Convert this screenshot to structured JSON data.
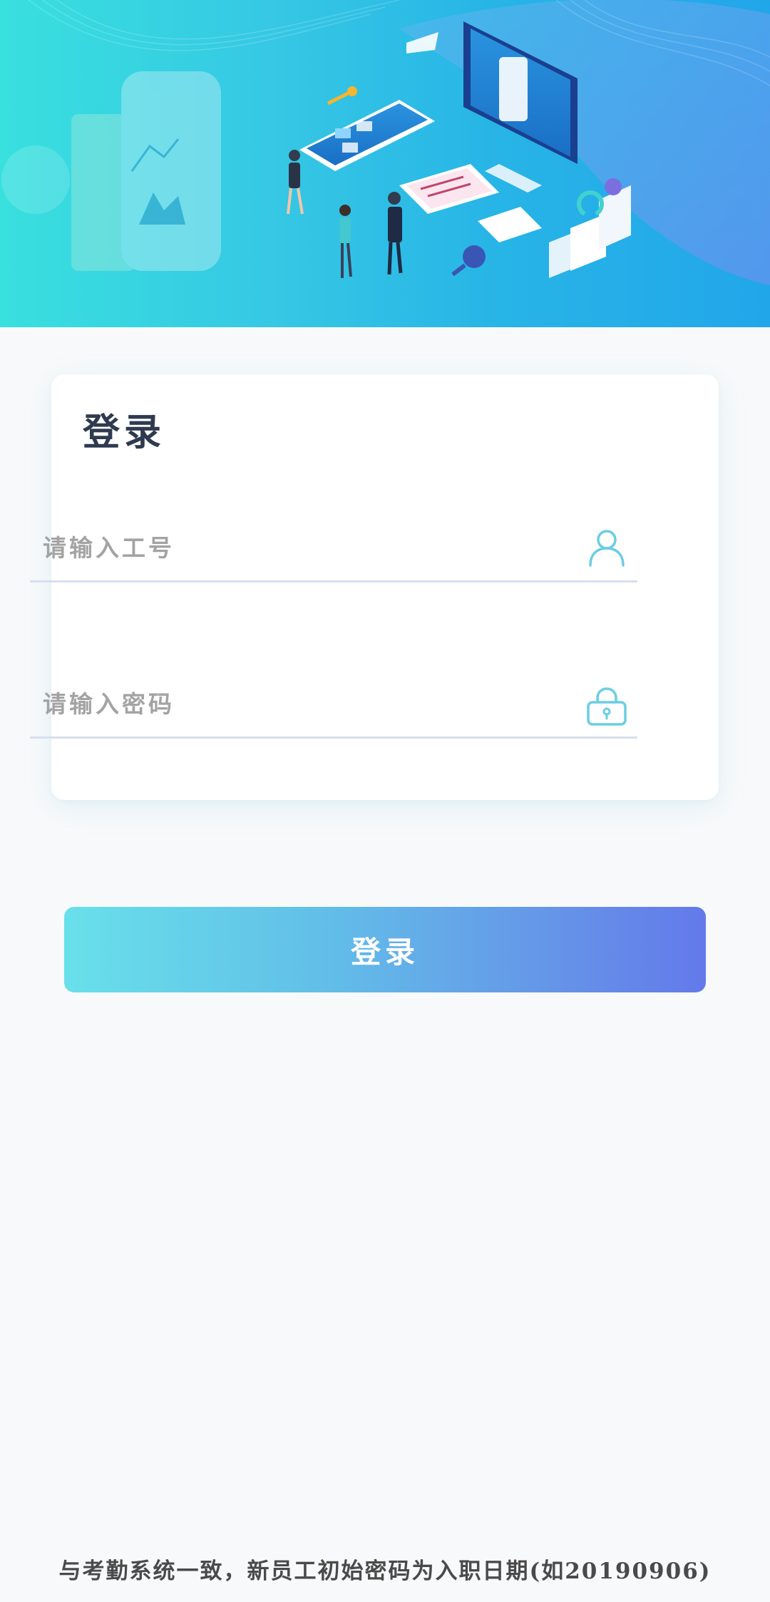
{
  "banner": {
    "illustration": "office-isometric-illustration"
  },
  "login": {
    "title": "登录",
    "username_placeholder": "请输入工号",
    "username_value": "",
    "password_placeholder": "请输入密码",
    "password_value": "",
    "user_icon": "user-icon",
    "lock_icon": "lock-icon",
    "button_label": "登录"
  },
  "footer": {
    "hint": "与考勤系统一致，新员工初始密码为入职日期(如20190906)"
  },
  "colors": {
    "accent": "#6bcde3",
    "button_start": "#68e0ea",
    "button_end": "#6479ea",
    "title": "#2e3a4f"
  }
}
